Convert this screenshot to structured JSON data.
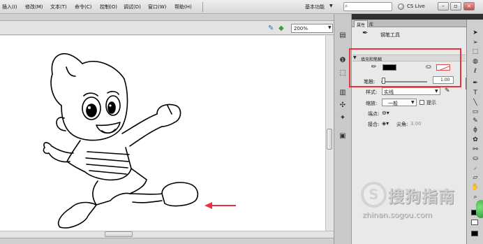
{
  "menubar": {
    "items": [
      "插入(I)",
      "修改(M)",
      "文本(T)",
      "命令(C)",
      "控制(O)",
      "调试(D)",
      "窗口(W)",
      "帮助(H)"
    ],
    "workspace": "基本功能",
    "cs_live": "CS Live"
  },
  "stage_toolbar": {
    "zoom": "200%"
  },
  "panel": {
    "tabs": [
      "属性",
      "库"
    ],
    "tool_name": "钢笔工具",
    "section_title": "填充和笔触",
    "stroke_color": "#000000",
    "stroke_label": "笔触:",
    "stroke_value": "1.00",
    "style_label": "样式:",
    "style_value": "实线",
    "scale_label": "缩放:",
    "scale_value": "一般",
    "hint_label": "提示",
    "cap_label": "端点:",
    "join_label": "接合:",
    "miter_label": "尖角:",
    "miter_value": "3.00"
  },
  "watermark": {
    "text": "搜狗指南",
    "url": "zhinan.sogou.com"
  },
  "icons": [
    "search-icon",
    "edit-symbol-icon",
    "edit-scene-icon",
    "pen-tool-icon",
    "pencil-icon",
    "paint-bucket-icon",
    "arrow-icon",
    "subselect-icon",
    "free-transform-icon",
    "text-tool-icon",
    "line-tool-icon",
    "rectangle-tool-icon",
    "brush-tool-icon",
    "hand-tool-icon",
    "zoom-tool-icon"
  ],
  "colors": {
    "highlight": "#e8333d",
    "accent_arrow": "#e8333d"
  }
}
